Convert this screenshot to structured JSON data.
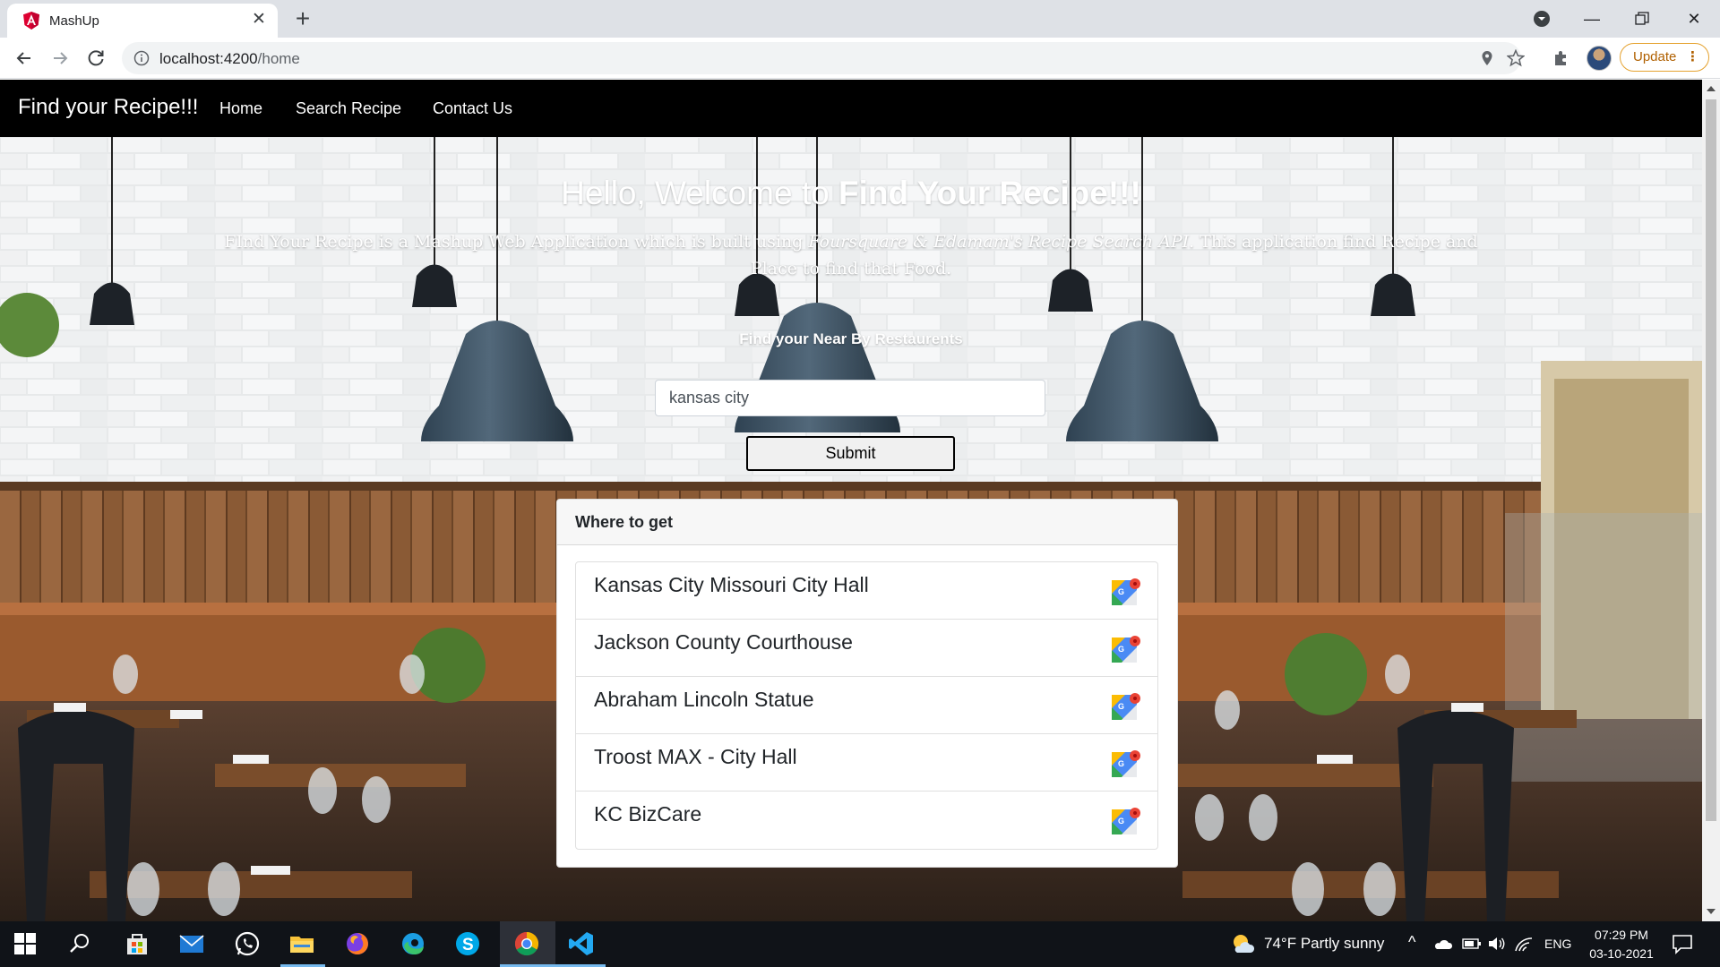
{
  "browser": {
    "tab_title": "MashUp",
    "url_host": "localhost:4200",
    "url_path": "/home",
    "update_label": "Update",
    "update_dots": "⋮"
  },
  "site": {
    "brand": "Find your Recipe!!!",
    "nav": [
      "Home",
      "Search Recipe",
      "Contact Us"
    ]
  },
  "hero": {
    "title_plain": "Hello, Welcome to ",
    "title_bold": "Find Your Recipe!!!",
    "desc_before": "FInd Your Recipe is a Mashup Web Application which is built using ",
    "desc_italic": "Foursquare & Edamam's Recipe Search API",
    "desc_after": ". This application find Recipe and Place to find that Food.",
    "near_label": "Find your Near By Restaurents"
  },
  "search": {
    "value": "kansas city",
    "submit_label": "Submit"
  },
  "results": {
    "header": "Where to get",
    "items": [
      {
        "name": "Kansas City Missouri City Hall"
      },
      {
        "name": "Jackson County Courthouse"
      },
      {
        "name": "Abraham Lincoln Statue"
      },
      {
        "name": "Troost MAX - City Hall"
      },
      {
        "name": "KC BizCare"
      }
    ]
  },
  "taskbar": {
    "weather": "74°F  Partly sunny",
    "lang": "ENG",
    "time": "07:29 PM",
    "date": "03-10-2021"
  },
  "colors": {
    "navbar": "#000000",
    "chrome_tabstrip": "#dee1e6",
    "taskbar": "#101318",
    "update_accent": "#e5a22f"
  }
}
